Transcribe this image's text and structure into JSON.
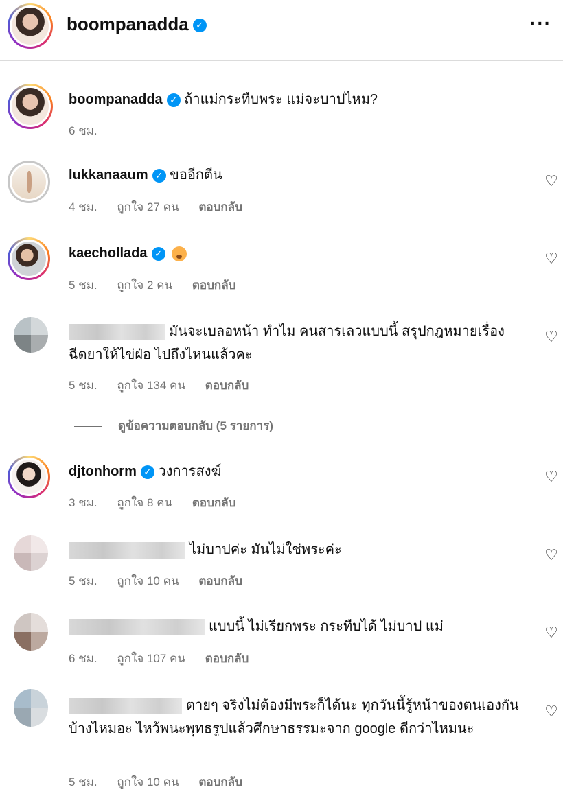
{
  "header": {
    "username": "boompanadda",
    "more_icon": "more-horizontal-icon"
  },
  "caption": {
    "username": "boompanadda",
    "text": "ถ้าแม่กระทืบพระ แม่จะบาปไหม?",
    "time": "6 ชม."
  },
  "comments": [
    {
      "username": "lukkanaaum",
      "verified": true,
      "text": "ขออีกตีน",
      "time": "4 ชม.",
      "likes": "ถูกใจ 27 คน",
      "reply": "ตอบกลับ"
    },
    {
      "username": "kaechollada",
      "verified": true,
      "text": "",
      "emoji": "face-emoji",
      "time": "5 ชม.",
      "likes": "ถูกใจ 2 คน",
      "reply": "ตอบกลับ"
    },
    {
      "username": "",
      "text": "มันจะเบลอหน้า ทำไม คนสารเลวแบบนี้ สรุปกฎหมายเรื่องฉีดยาให้ไข่ฝ่อ ไปถึงไหนแล้วคะ",
      "time": "5 ชม.",
      "likes": "ถูกใจ 134 คน",
      "reply": "ตอบกลับ"
    },
    {
      "username": "djtonhorm",
      "verified": true,
      "text": "วงการสงฆ์",
      "time": "3 ชม.",
      "likes": "ถูกใจ 8 คน",
      "reply": "ตอบกลับ"
    },
    {
      "username": "",
      "text": "ไม่บาปค่ะ มันไม่ใช่พระค่ะ",
      "time": "5 ชม.",
      "likes": "ถูกใจ 10 คน",
      "reply": "ตอบกลับ"
    },
    {
      "username": "",
      "text": "แบบนี้ ไม่เรียกพระ กระทืบได้ ไม่บาป แม่",
      "time": "6 ชม.",
      "likes": "ถูกใจ 107 คน",
      "reply": "ตอบกลับ"
    },
    {
      "username": "",
      "text": "ตายๆ จริงไม่ต้องมีพระก็ได้นะ ทุกวันนี้รู้หน้าของตนเองกันบ้างไหมอะ ไหว้พนะพุทธรูปแล้วศึกษาธรรมะจาก google ดีกว่าไหมนะ",
      "time": "5 ชม.",
      "likes": "ถูกใจ 10 คน",
      "reply": "ตอบกลับ"
    }
  ],
  "view_replies": "ดูข้อความตอบกลับ (5 รายการ)",
  "colors": {
    "verified": "#0095f6",
    "muted": "#737373"
  },
  "icons": {
    "verified": "verified-badge-icon",
    "heart": "heart-outline-icon"
  }
}
